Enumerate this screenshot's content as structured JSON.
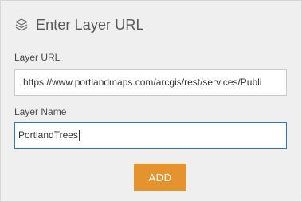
{
  "header": {
    "title": "Enter Layer URL",
    "icon": "layers-icon"
  },
  "form": {
    "url_label": "Layer URL",
    "url_value": "https://www.portlandmaps.com/arcgis/rest/services/Publi",
    "name_label": "Layer Name",
    "name_value": "PortlandTrees",
    "add_label": "ADD"
  },
  "colors": {
    "panel_background": "#efefef",
    "accent_button": "#e5932f",
    "focus_border": "#2d7ab8"
  }
}
